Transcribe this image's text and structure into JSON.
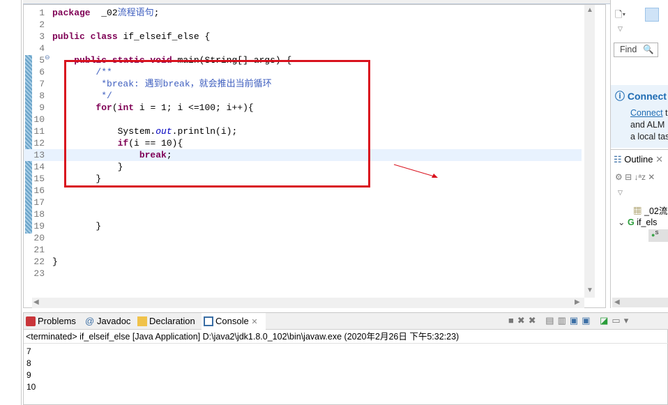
{
  "editor": {
    "lines": [
      {
        "n": "1",
        "segs": [
          [
            "kw",
            "package"
          ],
          [
            "",
            "  _02"
          ],
          [
            "cn",
            "流程语句"
          ],
          [
            "",
            ";"
          ]
        ]
      },
      {
        "n": "2",
        "segs": []
      },
      {
        "n": "3",
        "segs": [
          [
            "kw",
            "public"
          ],
          [
            "",
            " "
          ],
          [
            "kw",
            "class"
          ],
          [
            "",
            " if_elseif_else {"
          ]
        ]
      },
      {
        "n": "4",
        "segs": []
      },
      {
        "n": "5",
        "segs": [
          [
            "",
            "    "
          ],
          [
            "kw strike",
            "public static void"
          ],
          [
            "strike",
            " main(String[] "
          ],
          [
            "strike",
            "args) {"
          ]
        ]
      },
      {
        "n": "6",
        "segs": [
          [
            "doc",
            "        /**"
          ]
        ]
      },
      {
        "n": "7",
        "segs": [
          [
            "doc",
            "         *break: "
          ],
          [
            "cn",
            "遇到"
          ],
          [
            "doc",
            "break"
          ],
          [
            "cn",
            "，就会推出当前循环"
          ]
        ]
      },
      {
        "n": "8",
        "segs": [
          [
            "doc",
            "         */"
          ]
        ]
      },
      {
        "n": "9",
        "segs": [
          [
            "",
            "        "
          ],
          [
            "kw",
            "for"
          ],
          [
            "",
            "("
          ],
          [
            "kw",
            "int"
          ],
          [
            "",
            " i = 1; i <=100; i++){"
          ]
        ]
      },
      {
        "n": "10",
        "segs": []
      },
      {
        "n": "11",
        "segs": [
          [
            "",
            "            System."
          ],
          [
            "fld",
            "out"
          ],
          [
            "",
            ".println(i);"
          ]
        ]
      },
      {
        "n": "12",
        "segs": [
          [
            "",
            "            "
          ],
          [
            "kw",
            "if"
          ],
          [
            "",
            "(i == 10){"
          ]
        ]
      },
      {
        "n": "13",
        "segs": [
          [
            "",
            "                "
          ],
          [
            "kw",
            "break"
          ],
          [
            "",
            ";"
          ]
        ]
      },
      {
        "n": "14",
        "segs": [
          [
            "",
            "            }"
          ]
        ]
      },
      {
        "n": "15",
        "segs": [
          [
            "",
            "        }"
          ]
        ]
      },
      {
        "n": "16",
        "segs": []
      },
      {
        "n": "17",
        "segs": []
      },
      {
        "n": "18",
        "segs": []
      },
      {
        "n": "19",
        "segs": [
          [
            "",
            "        }"
          ]
        ]
      },
      {
        "n": "20",
        "segs": []
      },
      {
        "n": "21",
        "segs": []
      },
      {
        "n": "22",
        "segs": [
          [
            "",
            "}"
          ]
        ]
      },
      {
        "n": "23",
        "segs": []
      }
    ],
    "current_line": 13
  },
  "right": {
    "find_placeholder": "Find",
    "connect_title": "Connect",
    "connect_link": "Connect",
    "connect_text1": " t",
    "connect_text2": "and ALM",
    "connect_text3": "a local tas",
    "outline_title": "Outline",
    "outline_package": "_02流",
    "outline_class": "if_els",
    "outline_method": "S"
  },
  "bottom": {
    "tabs": [
      {
        "label": "Problems",
        "icon": "problems-icon"
      },
      {
        "label": "Javadoc",
        "icon": "at-icon"
      },
      {
        "label": "Declaration",
        "icon": "declaration-icon"
      },
      {
        "label": "Console",
        "icon": "console-icon"
      }
    ],
    "status": "<terminated> if_elseif_else [Java Application] D:\\java2\\jdk1.8.0_102\\bin\\javaw.exe (2020年2月26日 下午5:32:23)",
    "output": [
      "7",
      "8",
      "9",
      "10"
    ]
  },
  "colors": {
    "annotation": "#d9121e",
    "keyword": "#7f0055",
    "javadoc": "#3f5fbf"
  }
}
